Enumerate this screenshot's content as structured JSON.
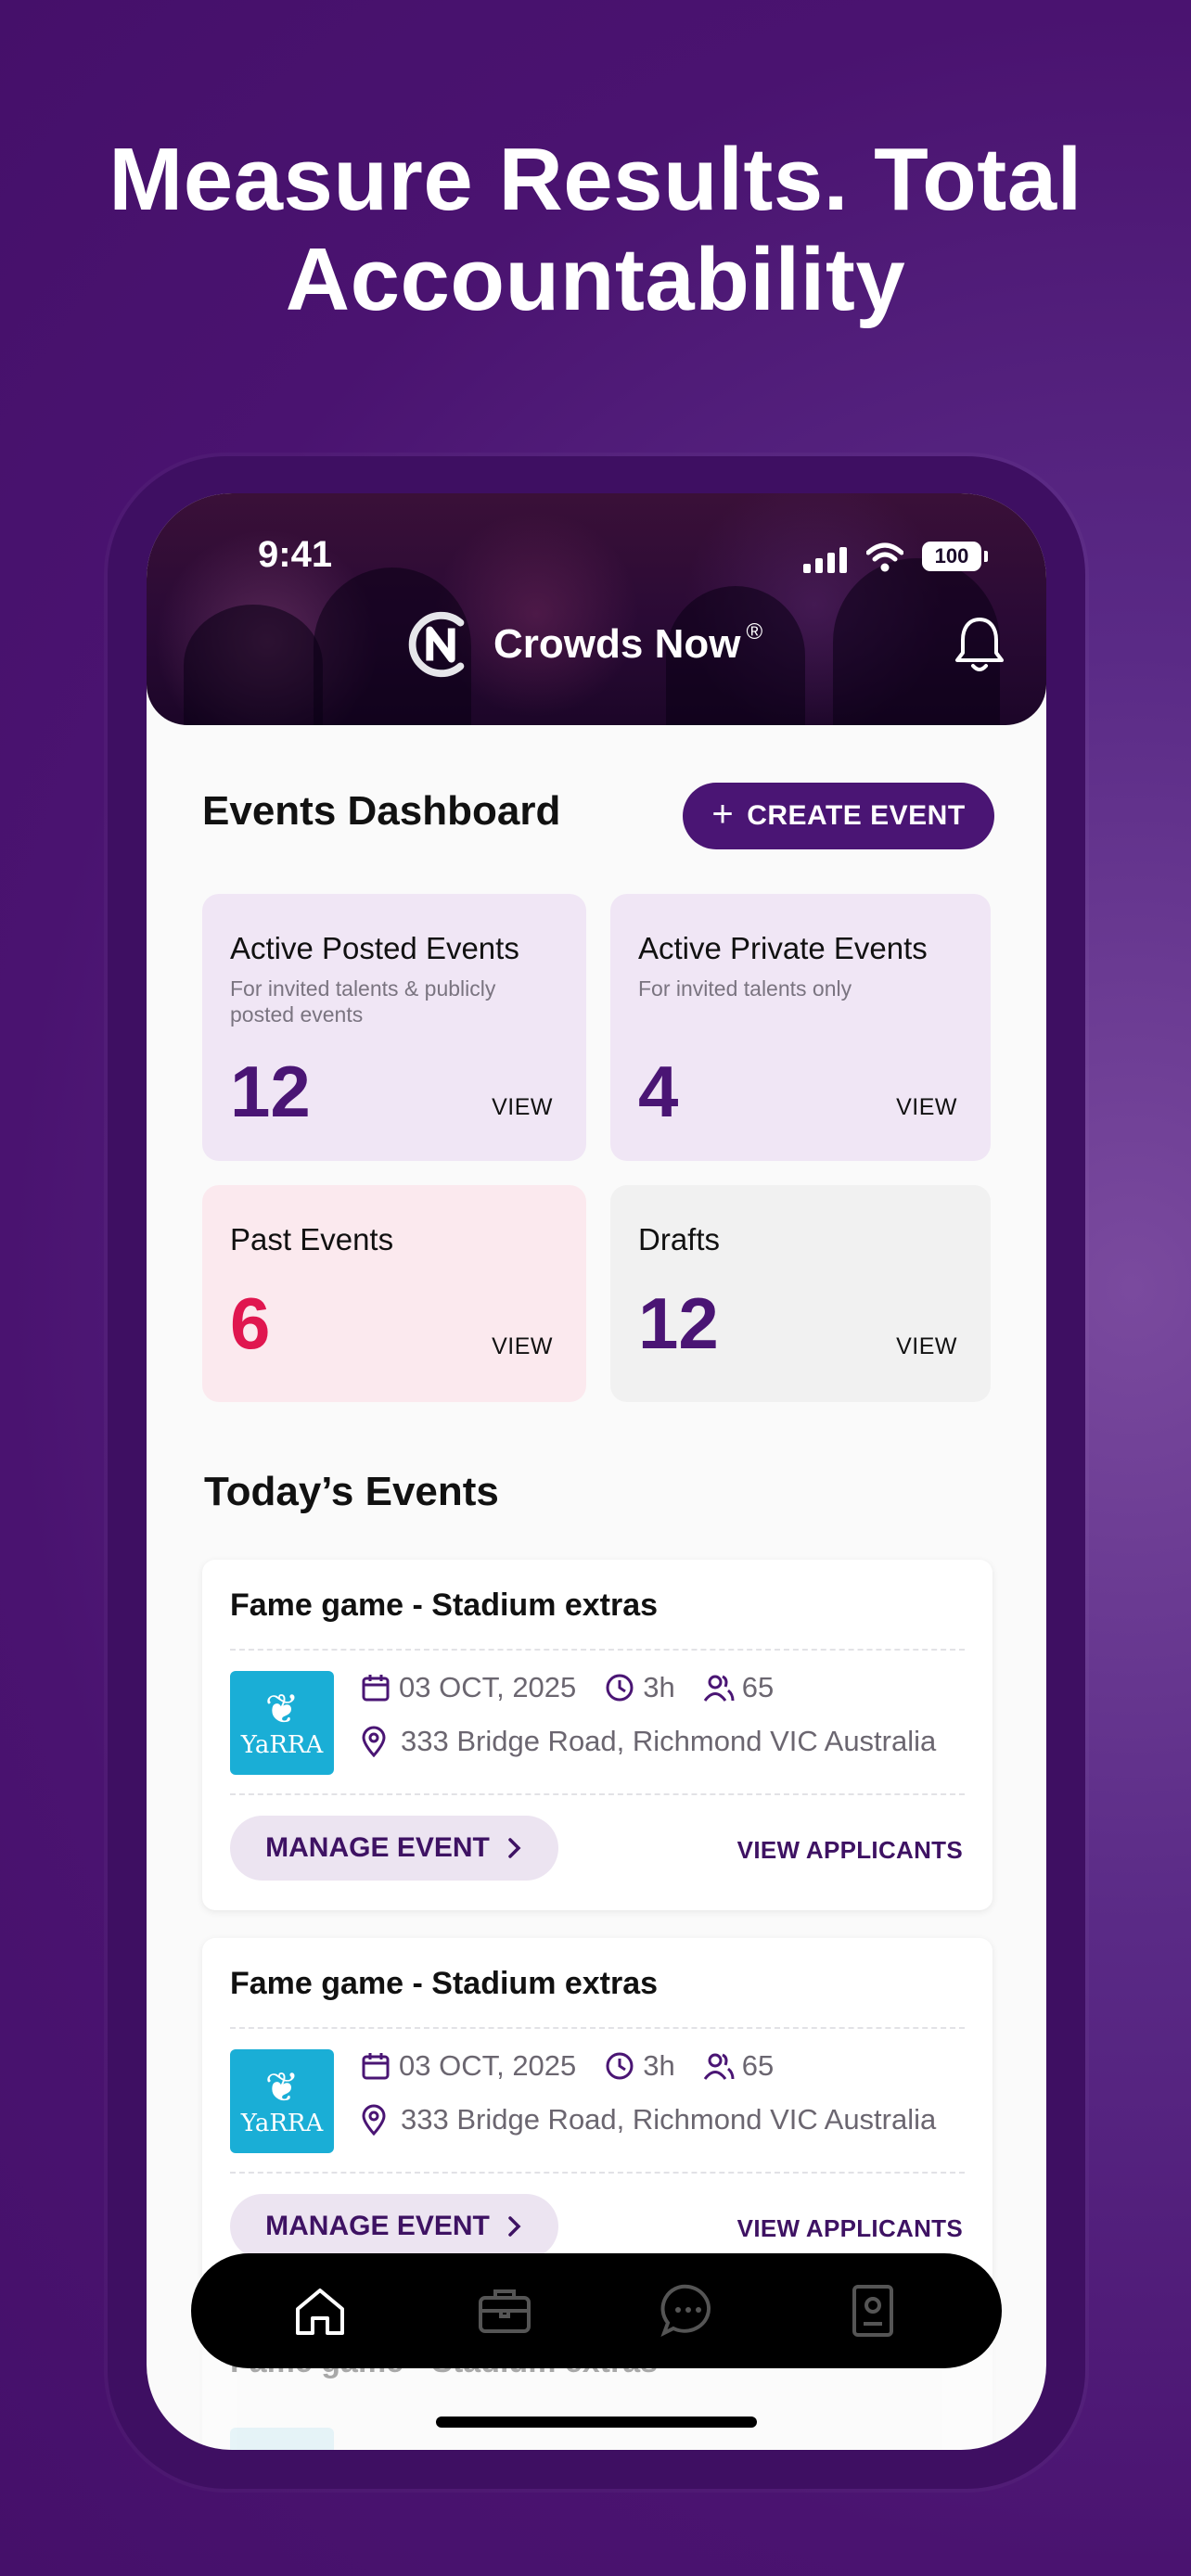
{
  "headline": "Measure Results. Total Accountability",
  "status_bar": {
    "time": "9:41",
    "battery": "100"
  },
  "header": {
    "brand_name": "Crowds Now",
    "brand_reg": "®"
  },
  "dashboard": {
    "title": "Events Dashboard",
    "create_button": "CREATE EVENT",
    "cards": [
      {
        "title": "Active Posted Events",
        "subtitle": "For invited talents & publicly posted events",
        "count": "12",
        "action": "VIEW",
        "count_color": "#4a1574"
      },
      {
        "title": "Active Private Events",
        "subtitle": "For invited talents only",
        "count": "4",
        "action": "VIEW",
        "count_color": "#4a1574"
      },
      {
        "title": "Past Events",
        "subtitle": "",
        "count": "6",
        "action": "VIEW",
        "count_color": "#e0164f"
      },
      {
        "title": "Drafts",
        "subtitle": "",
        "count": "12",
        "action": "VIEW",
        "count_color": "#4a1574"
      }
    ]
  },
  "today": {
    "title": "Today’s Events",
    "events": [
      {
        "title": "Fame game - Stadium extras",
        "logo_text": "YaRRA",
        "date": "03 OCT, 2025",
        "duration": "3h",
        "people": "65",
        "location": "333 Bridge Road, Richmond VIC Australia",
        "manage_label": "MANAGE EVENT",
        "applicants_label": "VIEW APPLICANTS"
      },
      {
        "title": "Fame game - Stadium extras",
        "logo_text": "YaRRA",
        "date": "03 OCT, 2025",
        "duration": "3h",
        "people": "65",
        "location": "333 Bridge Road, Richmond VIC Australia",
        "manage_label": "MANAGE EVENT",
        "applicants_label": "VIEW APPLICANTS"
      },
      {
        "title": "Fame game - Stadium extras",
        "logo_text": "",
        "date": "",
        "duration": "",
        "people": "",
        "location": "",
        "manage_label": "",
        "applicants_label": ""
      }
    ]
  },
  "tabbar": {
    "items": [
      "home-icon",
      "briefcase-icon",
      "chat-icon",
      "profile-card-icon"
    ],
    "active": "home-icon"
  },
  "colors": {
    "brand_purple": "#4a1574",
    "accent_red": "#e0164f",
    "background": "#4a1370"
  }
}
